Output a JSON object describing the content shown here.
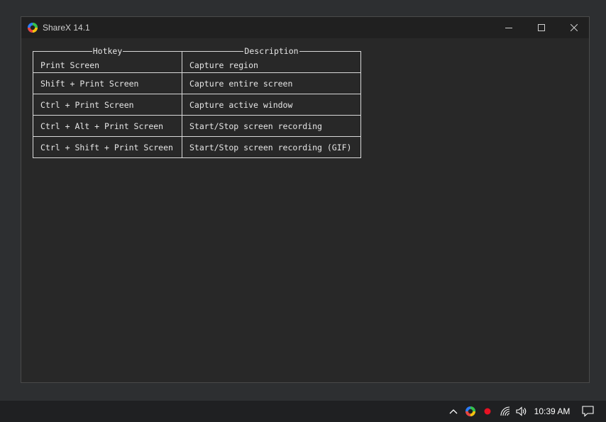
{
  "window": {
    "title": "ShareX 14.1"
  },
  "table": {
    "headers": [
      "Hotkey",
      "Description"
    ],
    "rows": [
      [
        "Print Screen",
        "Capture region"
      ],
      [
        "Shift + Print Screen",
        "Capture entire screen"
      ],
      [
        "Ctrl + Print Screen",
        "Capture active window"
      ],
      [
        "Ctrl + Alt + Print Screen",
        "Start/Stop screen recording"
      ],
      [
        "Ctrl + Shift + Print Screen",
        "Start/Stop screen recording (GIF)"
      ]
    ]
  },
  "taskbar": {
    "time": "10:39 AM",
    "tray_icons": [
      "chevron-up-icon",
      "sharex-icon",
      "record-icon",
      "wifi-icon",
      "volume-icon",
      "notification-icon"
    ]
  },
  "colors": {
    "window_bg": "#282828",
    "titlebar_bg": "#202020",
    "desktop_bg": "#2d2f31",
    "taskbar_bg": "#1f2022",
    "table_border": "#d9d9d9",
    "record_dot": "#e81123"
  }
}
